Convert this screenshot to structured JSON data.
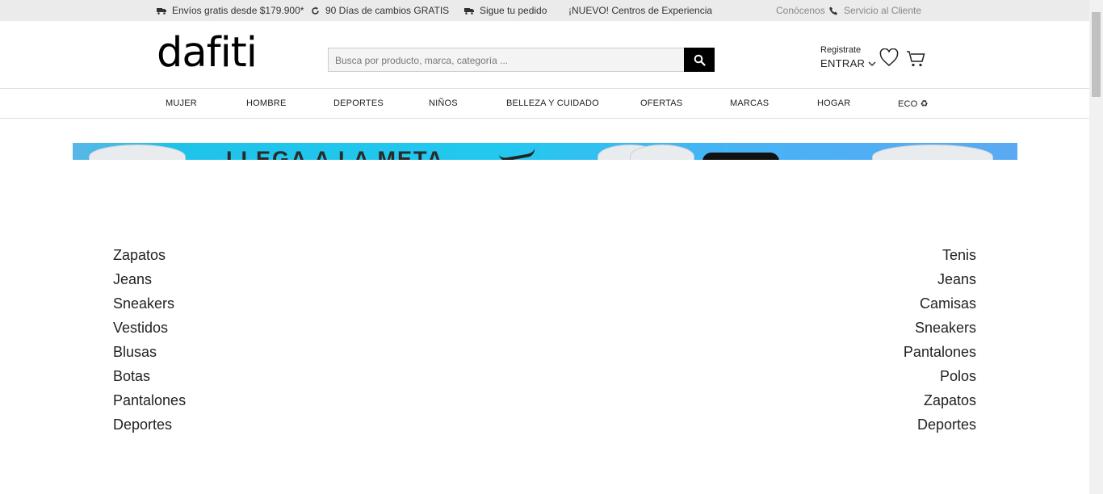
{
  "topbar": {
    "shipping": "Envíos gratis desde $179.900*",
    "returns": "90 Días de cambios GRATIS",
    "tracking": "Sigue tu pedido",
    "experience": "¡NUEVO! Centros de Experiencia",
    "about": "Conócenos",
    "support": "Servicio al Cliente"
  },
  "header": {
    "logo": "dafiti",
    "search_placeholder": "Busca por producto, marca, categoría ...",
    "register": "Registrate",
    "login": "ENTRAR"
  },
  "nav": {
    "items": [
      "MUJER",
      "HOMBRE",
      "DEPORTES",
      "NIÑOS",
      "BELLEZA Y CUIDADO",
      "OFERTAS",
      "MARCAS",
      "HOGAR",
      "ECO ♻"
    ]
  },
  "banner": {
    "headline": "LLEGA A LA META"
  },
  "links": {
    "left": [
      "Zapatos",
      "Jeans",
      "Sneakers",
      "Vestidos",
      "Blusas",
      "Botas",
      "Pantalones",
      "Deportes"
    ],
    "right": [
      "Tenis",
      "Jeans",
      "Camisas",
      "Sneakers",
      "Pantalones",
      "Polos",
      "Zapatos",
      "Deportes"
    ]
  },
  "icons": {
    "truck": "truck-icon",
    "refresh": "refresh-icon",
    "phone": "phone-icon",
    "search": "search-icon",
    "heart": "heart-icon",
    "cart": "cart-icon"
  }
}
